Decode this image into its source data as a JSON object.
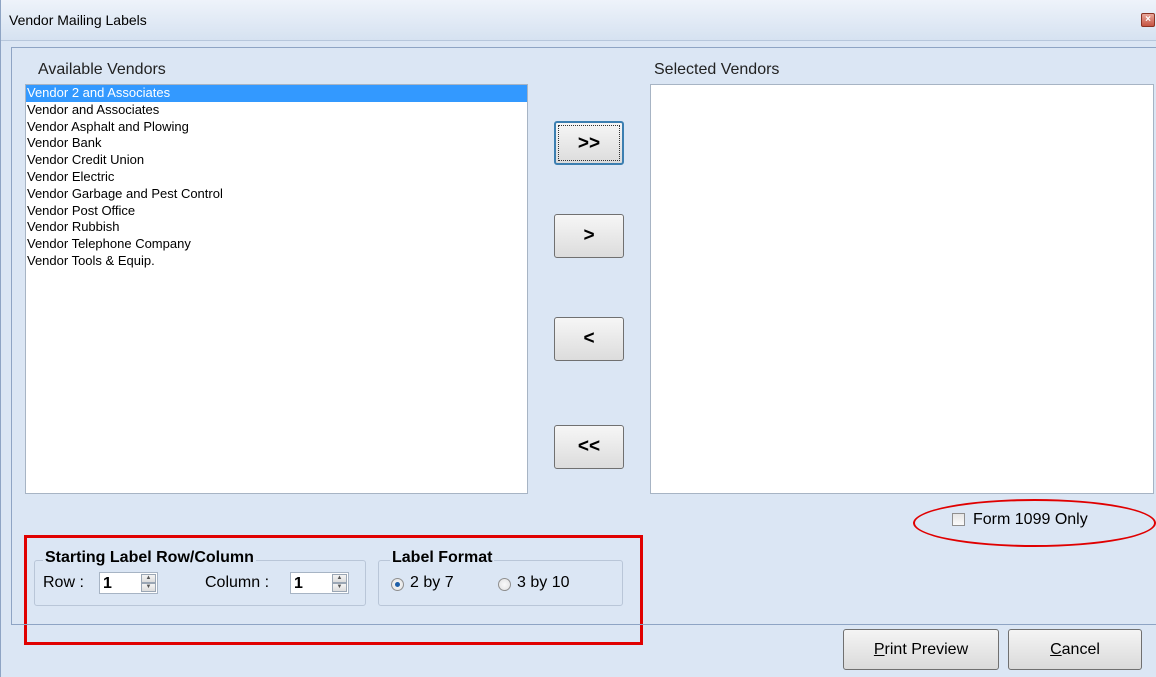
{
  "window": {
    "title": "Vendor Mailing Labels"
  },
  "available": {
    "label": "Available Vendors",
    "items": [
      "Vendor 2 and Associates",
      "Vendor and Associates",
      "Vendor Asphalt and Plowing",
      "Vendor Bank",
      "Vendor Credit Union",
      "Vendor Electric",
      "Vendor Garbage and Pest Control",
      "Vendor Post Office",
      "Vendor Rubbish",
      "Vendor Telephone Company",
      "Vendor Tools & Equip."
    ],
    "selected_item": "Vendor 2 and Associates"
  },
  "selected": {
    "label": "Selected Vendors",
    "items": []
  },
  "transfer": {
    "add_all": ">>",
    "add": ">",
    "remove": "<",
    "remove_all": "<<"
  },
  "form1099": {
    "label": "Form 1099 Only",
    "checked": false
  },
  "starting": {
    "title": "Starting Label Row/Column",
    "row_label": "Row :",
    "row_value": "1",
    "col_label": "Column :",
    "col_value": "1"
  },
  "format": {
    "title": "Label Format",
    "options": [
      "2 by 7",
      "3 by 10"
    ],
    "selected": "2 by 7"
  },
  "buttons": {
    "preview_mnemonic": "P",
    "preview_rest": "rint Preview",
    "cancel_mnemonic": "C",
    "cancel_rest": "ancel"
  },
  "annotation_color": "#e00000"
}
